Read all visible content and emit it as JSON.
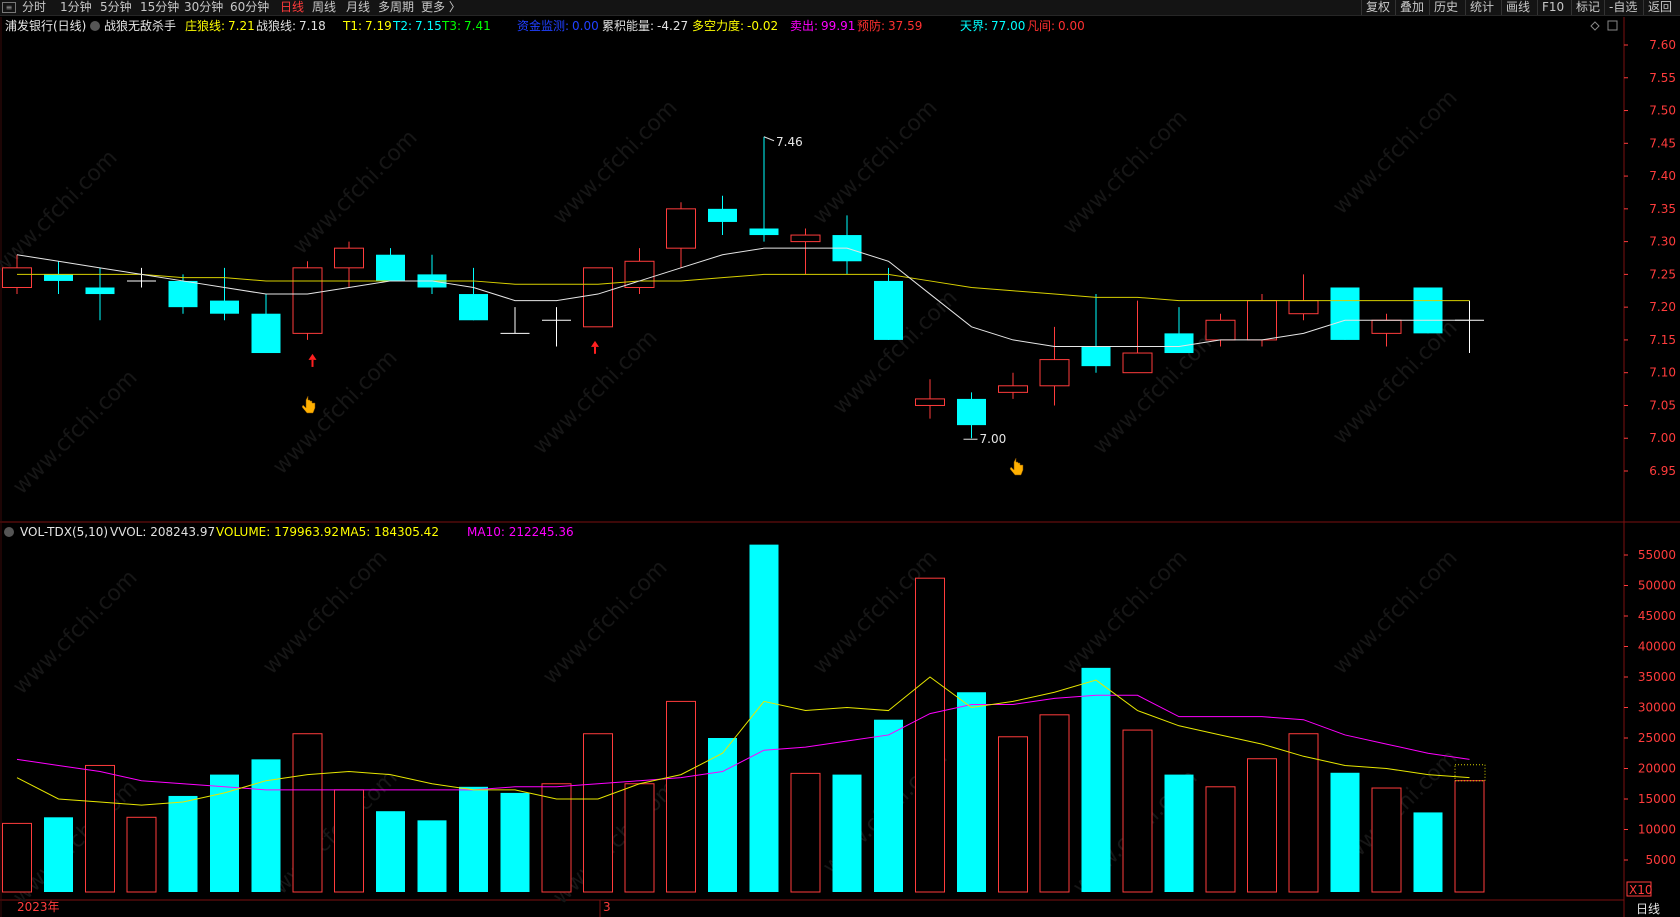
{
  "toolbar": {
    "periods": [
      {
        "label": "分时",
        "active": false
      },
      {
        "label": "1分钟",
        "active": false
      },
      {
        "label": "5分钟",
        "active": false
      },
      {
        "label": "15分钟",
        "active": false
      },
      {
        "label": "30分钟",
        "active": false
      },
      {
        "label": "60分钟",
        "active": false
      },
      {
        "label": "日线",
        "active": true
      },
      {
        "label": "周线",
        "active": false
      },
      {
        "label": "月线",
        "active": false
      },
      {
        "label": "多周期",
        "active": false
      },
      {
        "label": "更多 〉",
        "active": false
      }
    ],
    "tools": [
      "复权",
      "叠加",
      "历史",
      "统计",
      "画线",
      "F10",
      "标记",
      "-自选",
      "返回"
    ]
  },
  "header": {
    "stock": "浦发银行(日线)",
    "indicator": "战狼无敌杀手",
    "items": [
      {
        "label": "庄狼线:",
        "value": "7.21",
        "color": "#ffff00",
        "vcolor": "#ffff00"
      },
      {
        "label": "战狼线:",
        "value": "7.18",
        "color": "#e0e0e0",
        "vcolor": "#e0e0e0"
      },
      {
        "label": "T1:",
        "value": "7.19",
        "color": "#ffff00",
        "vcolor": "#ffff00"
      },
      {
        "label": "T2:",
        "value": "7.15",
        "color": "#00ffff",
        "vcolor": "#00ffff"
      },
      {
        "label": "T3:",
        "value": "7.41",
        "color": "#00ff00",
        "vcolor": "#00ff00"
      },
      {
        "label": "资金监测:",
        "value": "0.00",
        "color": "#2040ff",
        "vcolor": "#2040ff"
      },
      {
        "label": "累积能量:",
        "value": "-4.27",
        "color": "#e0e0e0",
        "vcolor": "#e0e0e0"
      },
      {
        "label": "多空力度:",
        "value": "-0.02",
        "color": "#ffff00",
        "vcolor": "#ffff00"
      },
      {
        "label": "卖出:",
        "value": "99.91",
        "color": "#ff00ff",
        "vcolor": "#ff00ff"
      },
      {
        "label": "预防:",
        "value": "37.59",
        "color": "#ff3030",
        "vcolor": "#ff3030"
      },
      {
        "label": "天界:",
        "value": "77.00",
        "color": "#00ffff",
        "vcolor": "#00ffff"
      },
      {
        "label": "凡间:",
        "value": "0.00",
        "color": "#ff3030",
        "vcolor": "#ff3030"
      }
    ]
  },
  "vol_header": {
    "name": "VOL-TDX(5,10)",
    "items": [
      {
        "label": "VVOL:",
        "value": "208243.97",
        "color": "#e0e0e0"
      },
      {
        "label": "VOLUME:",
        "value": "179963.92",
        "color": "#ffff00"
      },
      {
        "label": "MA5:",
        "value": "184305.42",
        "color": "#ffff00"
      },
      {
        "label": "MA10:",
        "value": "212245.36",
        "color": "#ff00ff"
      }
    ]
  },
  "footer": {
    "year_label": "2023年",
    "month_label": "3",
    "period_label": "日线",
    "vol_unit": "X10"
  },
  "annotations": {
    "high_label": "7.46",
    "low_label": "7.00"
  },
  "chart_data": [
    {
      "type": "candlestick",
      "ylim": [
        6.9,
        7.64
      ],
      "y_ticks": [
        "7.60",
        "7.55",
        "7.50",
        "7.45",
        "7.40",
        "7.35",
        "7.30",
        "7.25",
        "7.20",
        "7.15",
        "7.10",
        "7.05",
        "7.00",
        "6.95"
      ],
      "candles": [
        {
          "o": 7.23,
          "h": 7.28,
          "l": 7.22,
          "c": 7.26,
          "up": true
        },
        {
          "o": 7.25,
          "h": 7.27,
          "l": 7.22,
          "c": 7.24,
          "up": false
        },
        {
          "o": 7.23,
          "h": 7.26,
          "l": 7.18,
          "c": 7.22,
          "up": false
        },
        {
          "o": 7.24,
          "h": 7.26,
          "l": 7.23,
          "c": 7.24,
          "up": false
        },
        {
          "o": 7.24,
          "h": 7.25,
          "l": 7.19,
          "c": 7.2,
          "up": false
        },
        {
          "o": 7.21,
          "h": 7.26,
          "l": 7.18,
          "c": 7.19,
          "up": false
        },
        {
          "o": 7.19,
          "h": 7.22,
          "l": 7.13,
          "c": 7.13,
          "up": false
        },
        {
          "o": 7.16,
          "h": 7.27,
          "l": 7.15,
          "c": 7.26,
          "up": true
        },
        {
          "o": 7.26,
          "h": 7.3,
          "l": 7.23,
          "c": 7.29,
          "up": true
        },
        {
          "o": 7.28,
          "h": 7.29,
          "l": 7.24,
          "c": 7.24,
          "up": false
        },
        {
          "o": 7.25,
          "h": 7.28,
          "l": 7.22,
          "c": 7.23,
          "up": false
        },
        {
          "o": 7.22,
          "h": 7.26,
          "l": 7.18,
          "c": 7.18,
          "up": false
        },
        {
          "o": 7.16,
          "h": 7.2,
          "l": 7.16,
          "c": 7.16,
          "up": false
        },
        {
          "o": 7.18,
          "h": 7.2,
          "l": 7.14,
          "c": 7.18,
          "up": false
        },
        {
          "o": 7.17,
          "h": 7.26,
          "l": 7.17,
          "c": 7.26,
          "up": true
        },
        {
          "o": 7.23,
          "h": 7.29,
          "l": 7.22,
          "c": 7.27,
          "up": true
        },
        {
          "o": 7.29,
          "h": 7.36,
          "l": 7.26,
          "c": 7.35,
          "up": true
        },
        {
          "o": 7.35,
          "h": 7.37,
          "l": 7.31,
          "c": 7.33,
          "up": false
        },
        {
          "o": 7.32,
          "h": 7.46,
          "l": 7.3,
          "c": 7.31,
          "up": false
        },
        {
          "o": 7.3,
          "h": 7.32,
          "l": 7.25,
          "c": 7.31,
          "up": true
        },
        {
          "o": 7.31,
          "h": 7.34,
          "l": 7.25,
          "c": 7.27,
          "up": false
        },
        {
          "o": 7.24,
          "h": 7.26,
          "l": 7.15,
          "c": 7.15,
          "up": false
        },
        {
          "o": 7.05,
          "h": 7.09,
          "l": 7.03,
          "c": 7.06,
          "up": true
        },
        {
          "o": 7.06,
          "h": 7.07,
          "l": 7.0,
          "c": 7.02,
          "up": false
        },
        {
          "o": 7.07,
          "h": 7.1,
          "l": 7.06,
          "c": 7.08,
          "up": true
        },
        {
          "o": 7.08,
          "h": 7.17,
          "l": 7.05,
          "c": 7.12,
          "up": true
        },
        {
          "o": 7.14,
          "h": 7.22,
          "l": 7.1,
          "c": 7.11,
          "up": false
        },
        {
          "o": 7.1,
          "h": 7.21,
          "l": 7.1,
          "c": 7.13,
          "up": true
        },
        {
          "o": 7.16,
          "h": 7.2,
          "l": 7.13,
          "c": 7.13,
          "up": false
        },
        {
          "o": 7.15,
          "h": 7.19,
          "l": 7.14,
          "c": 7.18,
          "up": true
        },
        {
          "o": 7.15,
          "h": 7.22,
          "l": 7.14,
          "c": 7.21,
          "up": true
        },
        {
          "o": 7.19,
          "h": 7.25,
          "l": 7.18,
          "c": 7.21,
          "up": true
        },
        {
          "o": 7.23,
          "h": 7.23,
          "l": 7.15,
          "c": 7.15,
          "up": false
        },
        {
          "o": 7.16,
          "h": 7.19,
          "l": 7.14,
          "c": 7.18,
          "up": true
        },
        {
          "o": 7.23,
          "h": 7.23,
          "l": 7.16,
          "c": 7.16,
          "up": false
        },
        {
          "o": 7.18,
          "h": 7.21,
          "l": 7.13,
          "c": 7.18,
          "up": false
        }
      ],
      "ma_white": [
        7.28,
        7.27,
        7.26,
        7.25,
        7.24,
        7.23,
        7.22,
        7.22,
        7.23,
        7.24,
        7.24,
        7.23,
        7.21,
        7.21,
        7.22,
        7.24,
        7.26,
        7.28,
        7.29,
        7.29,
        7.29,
        7.27,
        7.22,
        7.17,
        7.15,
        7.14,
        7.14,
        7.14,
        7.14,
        7.15,
        7.15,
        7.16,
        7.18,
        7.18,
        7.18,
        7.18
      ],
      "ma_yellow": [
        7.25,
        7.25,
        7.25,
        7.25,
        7.245,
        7.245,
        7.24,
        7.24,
        7.24,
        7.24,
        7.24,
        7.24,
        7.235,
        7.235,
        7.235,
        7.24,
        7.24,
        7.245,
        7.25,
        7.25,
        7.25,
        7.25,
        7.24,
        7.23,
        7.225,
        7.22,
        7.215,
        7.215,
        7.21,
        7.21,
        7.21,
        7.21,
        7.21,
        7.21,
        7.21,
        7.21
      ],
      "signal_arrows": [
        7,
        14
      ]
    },
    {
      "type": "bar",
      "series_name": "VOLUME",
      "ylim": [
        0,
        57000
      ],
      "y_ticks": [
        5000,
        10000,
        15000,
        20000,
        25000,
        30000,
        35000,
        40000,
        45000,
        50000,
        55000
      ],
      "values": [
        11000,
        12000,
        20500,
        12000,
        15500,
        19000,
        21500,
        25700,
        16500,
        13000,
        11500,
        17000,
        16000,
        17500,
        25700,
        17500,
        31000,
        25000,
        56700,
        19200,
        19000,
        28000,
        51200,
        32500,
        25200,
        28800,
        36500,
        26300,
        19000,
        17000,
        21600,
        25700,
        19300,
        16800,
        12800,
        18000
      ],
      "up": [
        true,
        false,
        true,
        true,
        false,
        false,
        false,
        true,
        true,
        false,
        false,
        false,
        false,
        true,
        true,
        true,
        true,
        false,
        false,
        true,
        false,
        false,
        true,
        false,
        true,
        true,
        false,
        true,
        false,
        true,
        true,
        true,
        false,
        true,
        false,
        true
      ],
      "ma5": [
        18500,
        15000,
        14500,
        14000,
        14500,
        16000,
        18000,
        19000,
        19500,
        19000,
        17500,
        16500,
        16500,
        15000,
        15000,
        17500,
        19000,
        22500,
        31000,
        29500,
        30000,
        29500,
        35000,
        30000,
        31000,
        32500,
        34500,
        29500,
        27000,
        25500,
        24000,
        22000,
        20500,
        20000,
        19000,
        18500
      ],
      "ma10": [
        21500,
        20500,
        19500,
        18000,
        17500,
        17000,
        16500,
        16500,
        16500,
        16500,
        16500,
        16500,
        17000,
        17000,
        17500,
        18000,
        18500,
        19500,
        23000,
        23500,
        24500,
        25500,
        29000,
        30500,
        30500,
        31500,
        32000,
        32000,
        28500,
        28500,
        28500,
        28000,
        25500,
        24000,
        22500,
        21500
      ]
    }
  ]
}
